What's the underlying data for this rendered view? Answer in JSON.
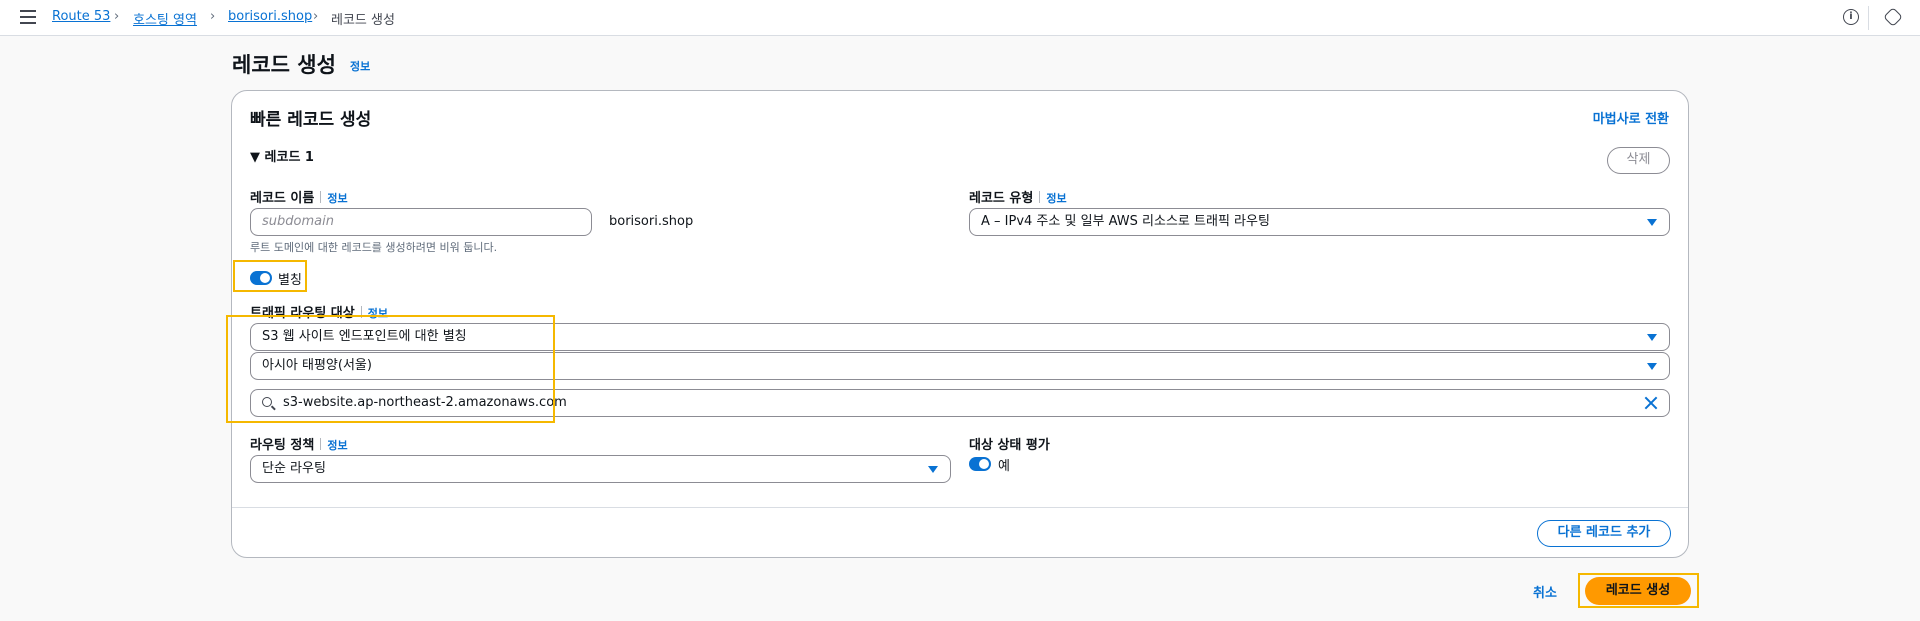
{
  "breadcrumbs": [
    "Route 53",
    "호스팅 영역",
    "borisori.shop",
    "레코드 생성"
  ],
  "page": {
    "title": "레코드 생성",
    "info": "정보"
  },
  "card": {
    "title": "빠른 레코드 생성",
    "wizard_link": "마법사로 전환",
    "section_label": "▼ 레코드 1",
    "delete_label": "삭제"
  },
  "record_name": {
    "label": "레코드 이름",
    "info": "정보",
    "placeholder": "subdomain",
    "suffix": "borisori.shop",
    "helper": "루트 도메인에 대한 레코드를 생성하려면 비워 둡니다."
  },
  "record_type": {
    "label": "레코드 유형",
    "info": "정보",
    "value": "A – IPv4 주소 및 일부 AWS 리소스로 트래픽 라우팅"
  },
  "alias": {
    "label": "별칭",
    "enabled": true
  },
  "traffic_target": {
    "label": "트래픽 라우팅 대상",
    "info": "정보",
    "endpoint": "S3 웹 사이트 엔드포인트에 대한 별칭",
    "region": "아시아 태평양(서울)",
    "search_value": "s3-website.ap-northeast-2.amazonaws.com"
  },
  "routing_policy": {
    "label": "라우팅 정책",
    "info": "정보",
    "value": "단순 라우팅"
  },
  "health_eval": {
    "label": "대상 상태 평가",
    "value_label": "예",
    "enabled": true
  },
  "actions": {
    "add_record": "다른 레코드 추가",
    "cancel": "취소",
    "create": "레코드 생성"
  },
  "colors": {
    "accent": "#0972d3",
    "primary_button": "#ff9900",
    "highlight": "#f5b800"
  }
}
